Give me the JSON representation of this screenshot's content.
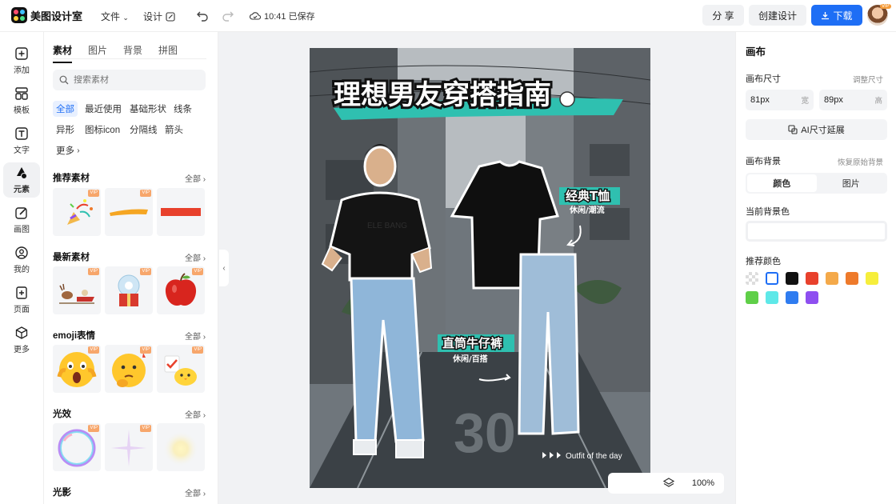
{
  "app": {
    "name": "美图设计室"
  },
  "header": {
    "file_label": "文件",
    "design_label": "设计",
    "saved_status": "10:41 已保存",
    "share_label": "分 享",
    "create_label": "创建设计",
    "download_label": "下载",
    "avatar_badge": "VIP"
  },
  "rail": [
    {
      "label": "添加",
      "icon": "plus-square-icon"
    },
    {
      "label": "模板",
      "icon": "template-icon"
    },
    {
      "label": "文字",
      "icon": "text-icon"
    },
    {
      "label": "元素",
      "icon": "shapes-icon"
    },
    {
      "label": "画图",
      "icon": "pen-icon"
    },
    {
      "label": "我的",
      "icon": "user-icon"
    },
    {
      "label": "页面",
      "icon": "page-add-icon"
    },
    {
      "label": "更多",
      "icon": "cube-icon"
    }
  ],
  "panel": {
    "tabs": [
      "素材",
      "图片",
      "背景",
      "拼图"
    ],
    "search_placeholder": "搜索素材",
    "chips": [
      "全部",
      "最近使用",
      "基础形状",
      "线条",
      "异形",
      "图标icon",
      "分隔线",
      "箭头",
      "更多"
    ],
    "all_label": "全部",
    "vip_label": "VIP",
    "sections": [
      {
        "title": "推荐素材",
        "tiles": [
          "party-popper",
          "yellow-brush-stroke",
          "red-bar"
        ]
      },
      {
        "title": "最新素材",
        "tiles": [
          "reindeer-sleigh",
          "snow-globe-gift",
          "red-apple"
        ]
      },
      {
        "title": "emoji表情",
        "tiles": [
          "shocked-emoji",
          "thinking-emoji",
          "chick-emoji"
        ]
      },
      {
        "title": "光效",
        "tiles": [
          "bubble-ring",
          "star-sparkle",
          "glow"
        ]
      },
      {
        "title": "光影",
        "tiles": []
      }
    ]
  },
  "poster": {
    "headline": "理想男友穿搭指南",
    "tshirt_label": "经典T恤",
    "tshirt_sub": "休闲/潮流",
    "jeans_label": "直筒牛仔裤",
    "jeans_sub": "休闲/百搭",
    "tshirt_print": "ELE BANG",
    "road_number": "30",
    "footer": "Outfit of the day"
  },
  "zoom": {
    "level": "100%"
  },
  "right": {
    "title": "画布",
    "size_label": "画布尺寸",
    "resize_link": "调整尺寸",
    "width_value": "81px",
    "width_unit": "宽",
    "height_value": "89px",
    "height_unit": "高",
    "ai_extend": "AI尺寸延展",
    "bg_label": "画布背景",
    "restore_link": "恢复原始背景",
    "seg_color": "颜色",
    "seg_image": "图片",
    "current_bg_label": "当前背景色",
    "recommended_label": "推荐颜色",
    "swatches": [
      "transparent",
      "#ffffff",
      "#111111",
      "#e8412c",
      "#f4a94a",
      "#ee7a2b",
      "#f6ee3c",
      "#5fcf48",
      "#5ee8e8",
      "#2f7cf0",
      "#8e4ff0"
    ]
  },
  "colors": {
    "accent": "#1e6ef5",
    "teal": "#2fc0b0"
  }
}
